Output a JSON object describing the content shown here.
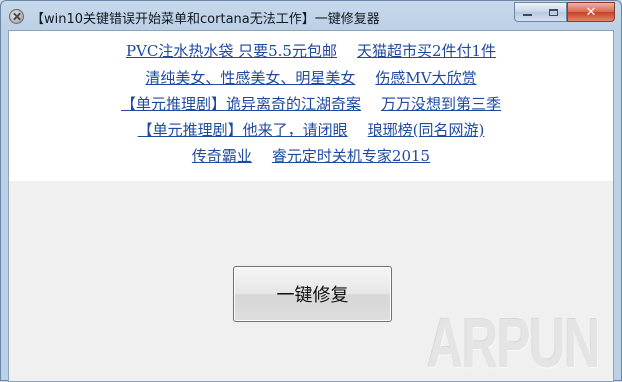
{
  "window": {
    "title": "【win10关键错误开始菜单和cortana无法工作】一键修复器",
    "close_glyph": "✕"
  },
  "links": {
    "row1": [
      "PVC注水热水袋 只要5.5元包邮",
      "天猫超市买2件付1件"
    ],
    "row2": [
      "清纯美女、性感美女、明星美女",
      "伤感MV大欣赏"
    ],
    "row3": [
      "【单元推理剧】诡异离奇的江湖奇案",
      "万万没想到第三季"
    ],
    "row4": [
      "【单元推理剧】他来了，请闭眼",
      "琅琊榜(同名网游)"
    ],
    "row5": [
      "传奇霸业",
      "睿元定时关机专家2015"
    ]
  },
  "main": {
    "repair_button_label": "一键修复"
  },
  "watermark": {
    "text": "ARPUN"
  },
  "colors": {
    "link": "#1f4aa0",
    "title_bar": "#bcd0e6",
    "client_bg": "#f0f0f0"
  }
}
